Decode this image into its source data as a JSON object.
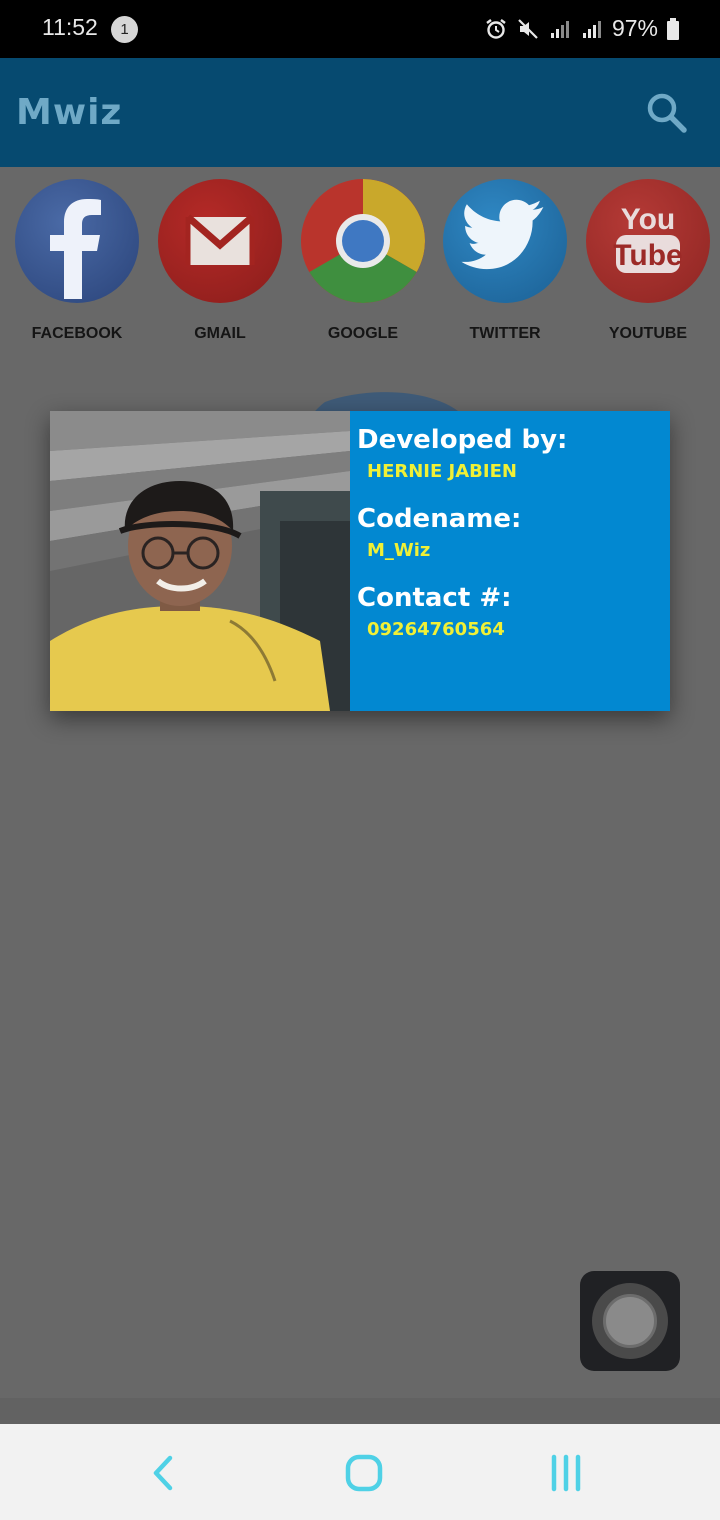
{
  "status_bar": {
    "time": "11:52",
    "notification_count": "1",
    "battery": "97%",
    "icons": [
      "alarm-icon",
      "mute-icon",
      "signal-icon",
      "signal-icon",
      "battery-icon"
    ]
  },
  "app_bar": {
    "title": "Mwiz",
    "search_icon": "search-icon"
  },
  "shortcuts": [
    {
      "label": "FACEBOOK",
      "icon": "facebook-icon",
      "color": "#3b5998"
    },
    {
      "label": "GMAIL",
      "icon": "gmail-icon",
      "color": "#c5221f"
    },
    {
      "label": "GOOGLE",
      "icon": "chrome-icon",
      "color": "#4285f4"
    },
    {
      "label": "TWITTER",
      "icon": "twitter-icon",
      "color": "#1da1f2"
    },
    {
      "label": "YOUTUBE",
      "icon": "youtube-icon",
      "color": "#e52d27"
    }
  ],
  "dialog": {
    "developed_by_label": "Developed by:",
    "developer_name": "HERNIE JABIEN",
    "codename_label": "Codename:",
    "codename": "M_Wiz",
    "contact_label": "Contact #:",
    "contact_number": "09264760564",
    "background_color": "#0288d1",
    "value_color": "#f0f036"
  },
  "colors": {
    "app_bar": "#064a70",
    "nav_icons": "#4fd1e6"
  },
  "nav_bar": {
    "buttons": [
      "back-icon",
      "home-icon",
      "recents-icon"
    ]
  }
}
